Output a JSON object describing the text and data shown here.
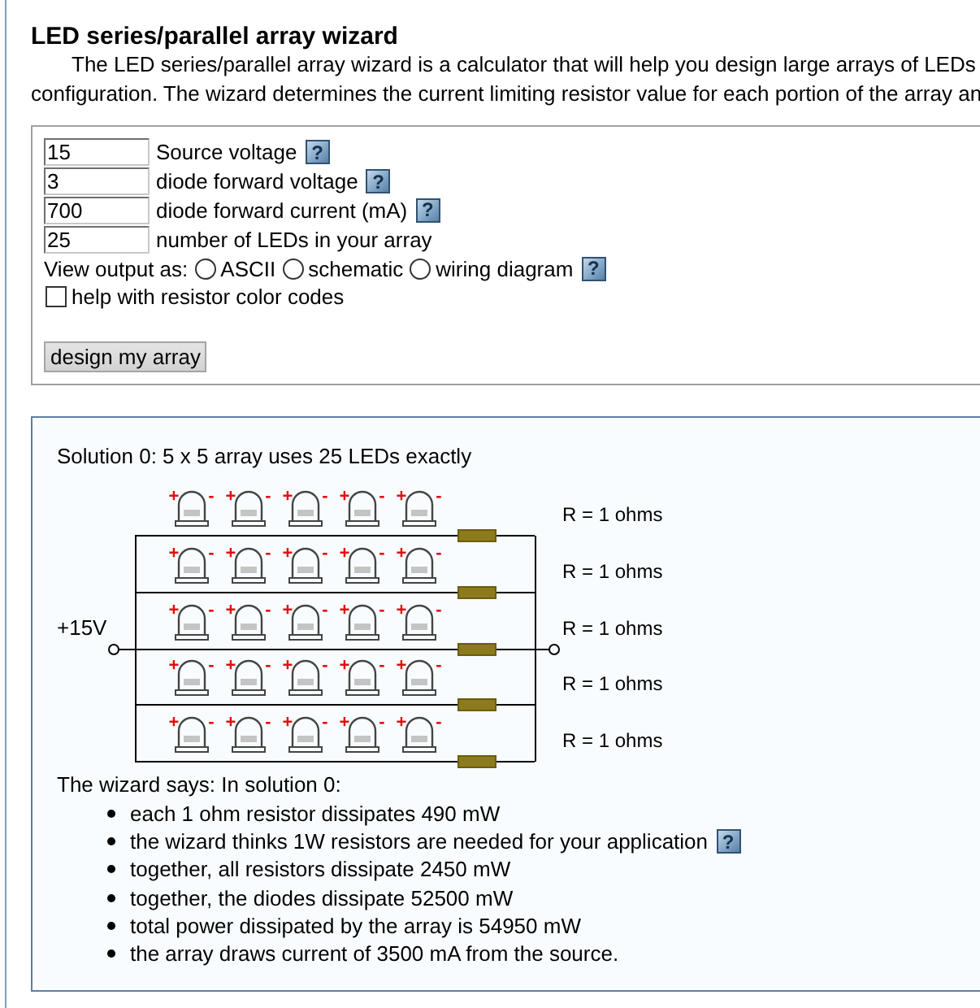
{
  "page": {
    "title": "LED series/parallel array wizard",
    "intro_lines": [
      "The LED series/parallel array wizard is a calculator that will help you design large arrays of LEDs",
      "configuration. The wizard determines the current limiting resistor value for each portion of the array an"
    ]
  },
  "form": {
    "fields": [
      {
        "value": "15",
        "label": "Source voltage",
        "help": "?"
      },
      {
        "value": "3",
        "label": "diode forward voltage",
        "help": "?"
      },
      {
        "value": "700",
        "label": "diode forward current (mA)",
        "help": "?"
      },
      {
        "value": "25",
        "label": "number of LEDs in your array"
      }
    ],
    "output": {
      "label": "View output as:",
      "options": [
        {
          "label": "ASCII",
          "selected": false
        },
        {
          "label": "schematic",
          "selected": false
        },
        {
          "label": "wiring diagram",
          "selected": false
        }
      ],
      "help": "?"
    },
    "color_help": {
      "label": "help with resistor color codes",
      "checked": false
    },
    "submit": "design my array"
  },
  "result": {
    "heading": "Solution 0: 5 x 5 array uses 25 LEDs exactly",
    "schematic": {
      "supply_label": "+15V",
      "strings": [
        {
          "leds": [
            {
              "anode": "+",
              "cathode": "-"
            },
            {
              "anode": "+",
              "cathode": "-"
            },
            {
              "anode": "+",
              "cathode": "-"
            },
            {
              "anode": "+",
              "cathode": "-"
            },
            {
              "anode": "+",
              "cathode": "-"
            }
          ],
          "resistor_label": "R = 1 ohms"
        },
        {
          "leds": [
            {
              "anode": "+",
              "cathode": "-"
            },
            {
              "anode": "+",
              "cathode": "-"
            },
            {
              "anode": "+",
              "cathode": "-"
            },
            {
              "anode": "+",
              "cathode": "-"
            },
            {
              "anode": "+",
              "cathode": "-"
            }
          ],
          "resistor_label": "R = 1 ohms"
        },
        {
          "leds": [
            {
              "anode": "+",
              "cathode": "-"
            },
            {
              "anode": "+",
              "cathode": "-"
            },
            {
              "anode": "+",
              "cathode": "-"
            },
            {
              "anode": "+",
              "cathode": "-"
            },
            {
              "anode": "+",
              "cathode": "-"
            }
          ],
          "resistor_label": "R = 1 ohms"
        },
        {
          "leds": [
            {
              "anode": "+",
              "cathode": "-"
            },
            {
              "anode": "+",
              "cathode": "-"
            },
            {
              "anode": "+",
              "cathode": "-"
            },
            {
              "anode": "+",
              "cathode": "-"
            },
            {
              "anode": "+",
              "cathode": "-"
            }
          ],
          "resistor_label": "R = 1 ohms"
        },
        {
          "leds": [
            {
              "anode": "+",
              "cathode": "-"
            },
            {
              "anode": "+",
              "cathode": "-"
            },
            {
              "anode": "+",
              "cathode": "-"
            },
            {
              "anode": "+",
              "cathode": "-"
            },
            {
              "anode": "+",
              "cathode": "-"
            }
          ],
          "resistor_label": "R = 1 ohms"
        }
      ]
    },
    "summary": "The wizard says: In solution 0:",
    "notes": [
      {
        "text": "each 1 ohm resistor dissipates 490 mW"
      },
      {
        "text": "the wizard thinks 1W resistors are needed for your application",
        "help": "?"
      },
      {
        "text": "together, all resistors dissipate 2450 mW"
      },
      {
        "text": "together, the diodes dissipate 52500 mW"
      },
      {
        "text": "total power dissipated by the array is 54950 mW"
      },
      {
        "text": "the array draws current of 3500 mA from the source."
      }
    ]
  }
}
